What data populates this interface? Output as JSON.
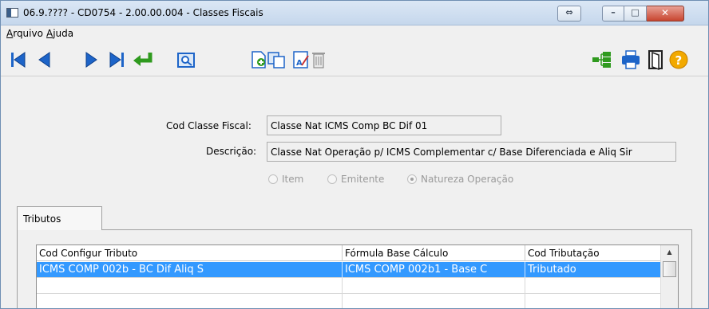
{
  "window": {
    "title": "06.9.???? - CD0754 - 2.00.00.004 - Classes Fiscais",
    "restore_glyph": "⇔",
    "minimize_glyph": "–",
    "maximize_glyph": "□",
    "close_glyph": "✕"
  },
  "menu": {
    "items": [
      {
        "accel": "A",
        "rest": "rquivo"
      },
      {
        "accel": "A",
        "rest": "juda"
      }
    ]
  },
  "toolbar": {
    "icons": [
      "first-record-icon",
      "previous-record-icon",
      "next-record-icon",
      "last-record-icon",
      "go-to-icon",
      "search-icon",
      "new-record-icon",
      "copy-record-icon",
      "edit-record-icon",
      "delete-record-icon",
      "tree-icon",
      "print-icon",
      "exit-icon",
      "help-icon"
    ],
    "help_glyph": "?"
  },
  "form": {
    "cod_label": "Cod Classe Fiscal:",
    "cod_value": "Classe Nat ICMS Comp BC Dif 01",
    "desc_label": "Descrição:",
    "desc_value": "Classe Nat Operação p/ ICMS Complementar c/ Base Diferenciada e Aliq Sir",
    "radios": [
      {
        "label": "Item",
        "selected": false
      },
      {
        "label": "Emitente",
        "selected": false
      },
      {
        "label": "Natureza Operação",
        "selected": true
      }
    ]
  },
  "tabs": [
    {
      "label": "Tributos",
      "active": true
    }
  ],
  "grid": {
    "columns": [
      "Cod Configur Tributo",
      "Fórmula Base Cálculo",
      "Cod Tributação"
    ],
    "rows": [
      [
        "ICMS COMP 002b - BC Dif Aliq S",
        "ICMS COMP 002b1 - Base C",
        "Tributado"
      ],
      [
        "",
        "",
        ""
      ],
      [
        "",
        "",
        ""
      ]
    ],
    "selected_row": 0,
    "scroll_up_glyph": "▲"
  },
  "colors": {
    "selection": "#3399ff",
    "titlebar": "#c5d7ec",
    "close_button": "#c7452f"
  }
}
